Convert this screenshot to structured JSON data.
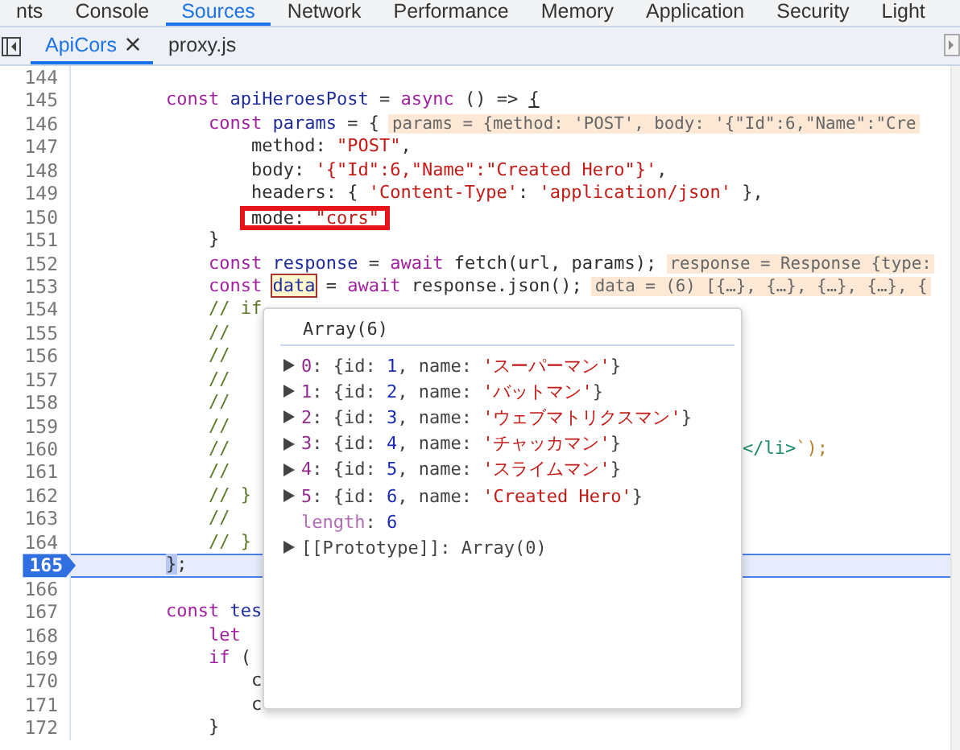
{
  "top_tabs": [
    {
      "label": "nts",
      "selected": false
    },
    {
      "label": "Console",
      "selected": false
    },
    {
      "label": "Sources",
      "selected": true
    },
    {
      "label": "Network",
      "selected": false
    },
    {
      "label": "Performance",
      "selected": false
    },
    {
      "label": "Memory",
      "selected": false
    },
    {
      "label": "Application",
      "selected": false
    },
    {
      "label": "Security",
      "selected": false
    },
    {
      "label": "Light",
      "selected": false
    }
  ],
  "file_tabs": [
    {
      "label": "ApiCors",
      "selected": true,
      "closable": true
    },
    {
      "label": "proxy.js",
      "selected": false,
      "closable": false
    }
  ],
  "code_lines": [
    {
      "number": "144",
      "current": false,
      "marked": false
    },
    {
      "number": "145",
      "current": false,
      "marked": false,
      "tokens": [
        {
          "kind": "kw",
          "text": "        const "
        },
        {
          "kind": "var",
          "text": "apiHeroesPost"
        },
        {
          "kind": "plain",
          "text": " = "
        },
        {
          "kind": "kw",
          "text": "async"
        },
        {
          "kind": "plain",
          "text": " () => "
        },
        {
          "kind": "match",
          "text": "{"
        }
      ]
    },
    {
      "number": "146",
      "current": false,
      "marked": false,
      "tokens": [
        {
          "kind": "kw",
          "text": "            const "
        },
        {
          "kind": "var",
          "text": "params"
        },
        {
          "kind": "plain",
          "text": " = {"
        },
        {
          "kind": "inline",
          "text": "params = {method: 'POST', body: '{\"Id\":6,\"Name\":\"Cre"
        }
      ]
    },
    {
      "number": "147",
      "current": false,
      "marked": false,
      "tokens": [
        {
          "kind": "plain",
          "text": "                method: "
        },
        {
          "kind": "str",
          "text": "\"POST\""
        },
        {
          "kind": "plain",
          "text": ","
        }
      ]
    },
    {
      "number": "148",
      "current": false,
      "marked": false,
      "tokens": [
        {
          "kind": "plain",
          "text": "                body: "
        },
        {
          "kind": "str",
          "text": "'{\"Id\":6,\"Name\":\"Created Hero\"}'"
        },
        {
          "kind": "plain",
          "text": ","
        }
      ]
    },
    {
      "number": "149",
      "current": false,
      "marked": false,
      "tokens": [
        {
          "kind": "plain",
          "text": "                headers: { "
        },
        {
          "kind": "str",
          "text": "'Content-Type'"
        },
        {
          "kind": "plain",
          "text": ": "
        },
        {
          "kind": "str",
          "text": "'application/json'"
        },
        {
          "kind": "plain",
          "text": " },"
        }
      ]
    },
    {
      "number": "150",
      "current": false,
      "marked": true,
      "tokens": [
        {
          "kind": "plain",
          "text": "                mode: "
        },
        {
          "kind": "str",
          "text": "\"cors\""
        }
      ]
    },
    {
      "number": "151",
      "current": false,
      "marked": false,
      "tokens": [
        {
          "kind": "plain",
          "text": "            }"
        }
      ]
    },
    {
      "number": "152",
      "current": false,
      "marked": false,
      "tokens": [
        {
          "kind": "kw",
          "text": "            const "
        },
        {
          "kind": "var",
          "text": "response"
        },
        {
          "kind": "plain",
          "text": " = "
        },
        {
          "kind": "kw",
          "text": "await "
        },
        {
          "kind": "plain",
          "text": "fetch(url, params);"
        },
        {
          "kind": "inline",
          "text": "response = Response {type:"
        }
      ]
    },
    {
      "number": "153",
      "current": false,
      "marked": false,
      "tokens": [
        {
          "kind": "kw",
          "text": "            const "
        },
        {
          "kind": "hover",
          "text": "data"
        },
        {
          "kind": "plain",
          "text": " = "
        },
        {
          "kind": "kw",
          "text": "await "
        },
        {
          "kind": "plain",
          "text": "response.json();"
        },
        {
          "kind": "inline",
          "text": "data = (6) [{…}, {…}, {…}, {…}, {"
        }
      ]
    },
    {
      "number": "154",
      "current": false,
      "marked": false,
      "tokens": [
        {
          "kind": "comment",
          "text": "            // if"
        }
      ]
    },
    {
      "number": "155",
      "current": false,
      "marked": false,
      "tokens": [
        {
          "kind": "comment",
          "text": "            //"
        }
      ]
    },
    {
      "number": "156",
      "current": false,
      "marked": false,
      "tokens": [
        {
          "kind": "comment",
          "text": "            //"
        }
      ]
    },
    {
      "number": "157",
      "current": false,
      "marked": false,
      "tokens": [
        {
          "kind": "comment",
          "text": "            //"
        }
      ]
    },
    {
      "number": "158",
      "current": false,
      "marked": false,
      "tokens": [
        {
          "kind": "comment",
          "text": "            //"
        }
      ]
    },
    {
      "number": "159",
      "current": false,
      "marked": false,
      "tokens": [
        {
          "kind": "comment",
          "text": "            //"
        }
      ]
    },
    {
      "number": "160",
      "current": false,
      "marked": false,
      "tokens": [
        {
          "kind": "comment",
          "text": "            //"
        }
      ],
      "tail": [
        {
          "kind": "tag",
          "text": "</li>"
        },
        {
          "kind": "tpl",
          "text": "`);"
        }
      ]
    },
    {
      "number": "161",
      "current": false,
      "marked": false,
      "tokens": [
        {
          "kind": "comment",
          "text": "            //"
        }
      ]
    },
    {
      "number": "162",
      "current": false,
      "marked": false,
      "tokens": [
        {
          "kind": "comment",
          "text": "            // }"
        }
      ]
    },
    {
      "number": "163",
      "current": false,
      "marked": false,
      "tokens": [
        {
          "kind": "comment",
          "text": "            //"
        }
      ]
    },
    {
      "number": "164",
      "current": false,
      "marked": false,
      "tokens": [
        {
          "kind": "comment",
          "text": "            // }"
        }
      ]
    },
    {
      "number": "165",
      "current": true,
      "marked": false,
      "tokens": [
        {
          "kind": "caret",
          "text": "        }"
        },
        {
          "kind": "plain",
          "text": ";"
        }
      ]
    },
    {
      "number": "166",
      "current": false,
      "marked": false
    },
    {
      "number": "167",
      "current": false,
      "marked": false,
      "tokens": [
        {
          "kind": "kw",
          "text": "        const "
        },
        {
          "kind": "var",
          "text": "tes"
        }
      ]
    },
    {
      "number": "168",
      "current": false,
      "marked": false,
      "tokens": [
        {
          "kind": "kw",
          "text": "            let"
        }
      ]
    },
    {
      "number": "169",
      "current": false,
      "marked": false,
      "tokens": [
        {
          "kind": "kw",
          "text": "            if"
        },
        {
          "kind": "plain",
          "text": " ("
        }
      ]
    },
    {
      "number": "170",
      "current": false,
      "marked": false,
      "tokens": [
        {
          "kind": "plain",
          "text": "                c"
        }
      ]
    },
    {
      "number": "171",
      "current": false,
      "marked": false,
      "tokens": [
        {
          "kind": "plain",
          "text": "                c"
        }
      ]
    },
    {
      "number": "172",
      "current": false,
      "marked": false,
      "tokens": [
        {
          "kind": "plain",
          "text": "            }"
        }
      ]
    }
  ],
  "popover": {
    "title": "Array(6)",
    "rows": [
      {
        "kind": "expandable",
        "expanded": false,
        "tokens": [
          {
            "kind": "key",
            "text": "0"
          },
          {
            "kind": "punct",
            "text": ": {id: "
          },
          {
            "kind": "num",
            "text": "1"
          },
          {
            "kind": "punct",
            "text": ", name: "
          },
          {
            "kind": "str",
            "text": "'スーパーマン'"
          },
          {
            "kind": "punct",
            "text": "}"
          }
        ]
      },
      {
        "kind": "expandable",
        "expanded": false,
        "tokens": [
          {
            "kind": "key",
            "text": "1"
          },
          {
            "kind": "punct",
            "text": ": {id: "
          },
          {
            "kind": "num",
            "text": "2"
          },
          {
            "kind": "punct",
            "text": ", name: "
          },
          {
            "kind": "str",
            "text": "'バットマン'"
          },
          {
            "kind": "punct",
            "text": "}"
          }
        ]
      },
      {
        "kind": "expandable",
        "expanded": false,
        "tokens": [
          {
            "kind": "key",
            "text": "2"
          },
          {
            "kind": "punct",
            "text": ": {id: "
          },
          {
            "kind": "num",
            "text": "3"
          },
          {
            "kind": "punct",
            "text": ", name: "
          },
          {
            "kind": "str",
            "text": "'ウェブマトリクスマン'"
          },
          {
            "kind": "punct",
            "text": "}"
          }
        ]
      },
      {
        "kind": "expandable",
        "expanded": false,
        "tokens": [
          {
            "kind": "key",
            "text": "3"
          },
          {
            "kind": "punct",
            "text": ": {id: "
          },
          {
            "kind": "num",
            "text": "4"
          },
          {
            "kind": "punct",
            "text": ", name: "
          },
          {
            "kind": "str",
            "text": "'チャッカマン'"
          },
          {
            "kind": "punct",
            "text": "}"
          }
        ]
      },
      {
        "kind": "expandable",
        "expanded": false,
        "tokens": [
          {
            "kind": "key",
            "text": "4"
          },
          {
            "kind": "punct",
            "text": ": {id: "
          },
          {
            "kind": "num",
            "text": "5"
          },
          {
            "kind": "punct",
            "text": ", name: "
          },
          {
            "kind": "str",
            "text": "'スライムマン'"
          },
          {
            "kind": "punct",
            "text": "}"
          }
        ]
      },
      {
        "kind": "expandable",
        "expanded": false,
        "tokens": [
          {
            "kind": "key",
            "text": "5"
          },
          {
            "kind": "punct",
            "text": ": {id: "
          },
          {
            "kind": "num",
            "text": "6"
          },
          {
            "kind": "punct",
            "text": ", name: "
          },
          {
            "kind": "str",
            "text": "'Created Hero'"
          },
          {
            "kind": "punct",
            "text": "}"
          }
        ]
      },
      {
        "kind": "leaf",
        "tokens": [
          {
            "kind": "dimkey",
            "text": "length"
          },
          {
            "kind": "punct",
            "text": ": "
          },
          {
            "kind": "num",
            "text": "6"
          }
        ]
      },
      {
        "kind": "expandable",
        "expanded": false,
        "tokens": [
          {
            "kind": "punct",
            "text": "[[Prototype]]: Array(0)"
          }
        ]
      }
    ]
  }
}
